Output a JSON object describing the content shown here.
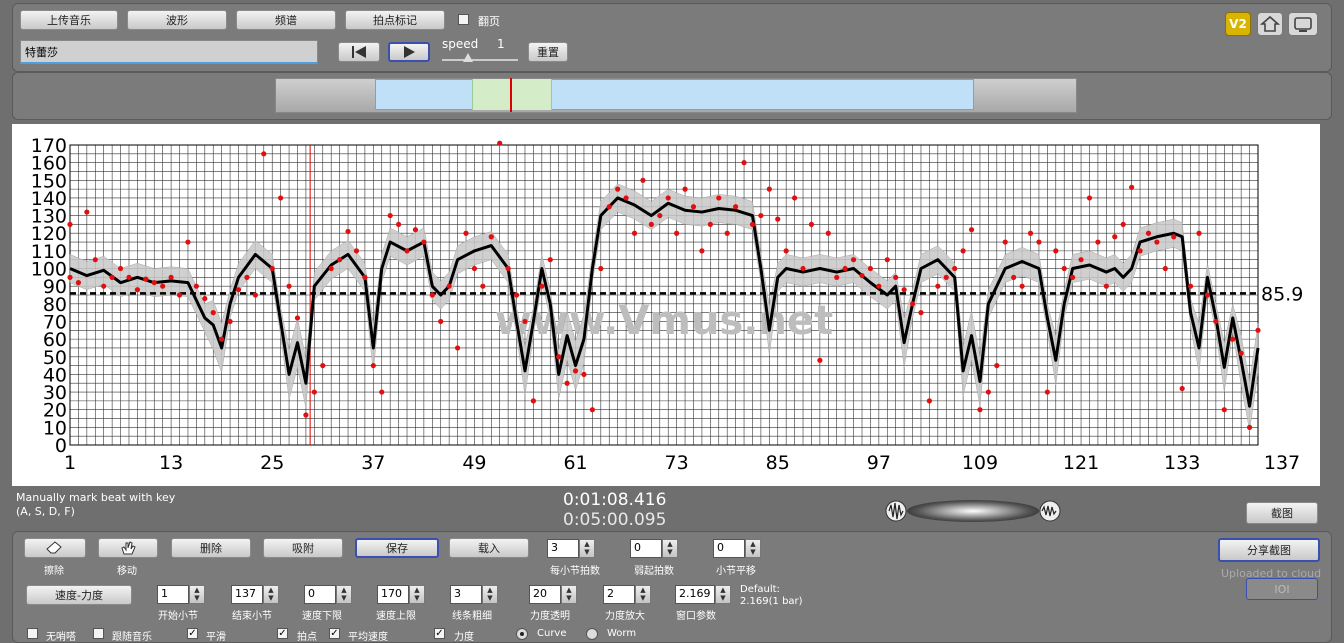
{
  "top": {
    "upload_label": "上传音乐",
    "waveform_label": "波形",
    "spectrum_label": "频谱",
    "beat_mark_label": "拍点标记",
    "flip_label": "翻页",
    "file_name": "特蕾莎",
    "speed_label": "speed",
    "speed_value": "1",
    "reset_label": "重置",
    "v2_label": "V2"
  },
  "colors": {
    "data_points": "#e01010",
    "curve": "#000000",
    "band": "#c8c8c8",
    "timeline_selection": "#bfe0f7",
    "accent_border": "#3a4fae"
  },
  "chart_data": {
    "type": "scatter",
    "ylim": [
      0,
      170
    ],
    "xlim": [
      1,
      137
    ],
    "yticks": [
      "0",
      "10",
      "20",
      "30",
      "40",
      "50",
      "60",
      "70",
      "80",
      "90",
      "100",
      "110",
      "120",
      "130",
      "140",
      "150",
      "160",
      "170"
    ],
    "xticks": [
      "1",
      "13",
      "25",
      "37",
      "49",
      "61",
      "73",
      "85",
      "97",
      "109",
      "121",
      "133",
      "137"
    ],
    "average_value": 85.9,
    "average_label": "85.9",
    "cursor_x": 29.5,
    "watermark": "www.Vmus.net",
    "curve": [
      [
        1,
        100
      ],
      [
        3,
        96
      ],
      [
        5,
        99
      ],
      [
        7,
        92
      ],
      [
        9,
        95
      ],
      [
        11,
        92
      ],
      [
        13,
        93
      ],
      [
        15,
        92
      ],
      [
        16,
        82
      ],
      [
        17,
        72
      ],
      [
        18,
        68
      ],
      [
        19,
        55
      ],
      [
        20,
        80
      ],
      [
        21,
        95
      ],
      [
        23,
        108
      ],
      [
        25,
        100
      ],
      [
        26,
        70
      ],
      [
        27,
        40
      ],
      [
        28,
        58
      ],
      [
        29,
        35
      ],
      [
        30,
        90
      ],
      [
        32,
        102
      ],
      [
        34,
        108
      ],
      [
        36,
        95
      ],
      [
        37,
        55
      ],
      [
        38,
        100
      ],
      [
        39,
        115
      ],
      [
        41,
        110
      ],
      [
        43,
        115
      ],
      [
        44,
        90
      ],
      [
        45,
        85
      ],
      [
        46,
        90
      ],
      [
        47,
        105
      ],
      [
        49,
        110
      ],
      [
        51,
        113
      ],
      [
        53,
        100
      ],
      [
        54,
        70
      ],
      [
        55,
        42
      ],
      [
        56,
        70
      ],
      [
        57,
        100
      ],
      [
        58,
        80
      ],
      [
        59,
        40
      ],
      [
        60,
        62
      ],
      [
        61,
        45
      ],
      [
        62,
        60
      ],
      [
        63,
        100
      ],
      [
        64,
        130
      ],
      [
        66,
        140
      ],
      [
        68,
        136
      ],
      [
        70,
        130
      ],
      [
        72,
        137
      ],
      [
        74,
        133
      ],
      [
        76,
        132
      ],
      [
        78,
        134
      ],
      [
        80,
        133
      ],
      [
        82,
        130
      ],
      [
        83,
        100
      ],
      [
        84,
        65
      ],
      [
        85,
        95
      ],
      [
        86,
        100
      ],
      [
        88,
        98
      ],
      [
        90,
        100
      ],
      [
        92,
        98
      ],
      [
        94,
        100
      ],
      [
        96,
        92
      ],
      [
        98,
        85
      ],
      [
        99,
        90
      ],
      [
        100,
        58
      ],
      [
        101,
        80
      ],
      [
        102,
        100
      ],
      [
        104,
        105
      ],
      [
        106,
        95
      ],
      [
        107,
        42
      ],
      [
        108,
        62
      ],
      [
        109,
        36
      ],
      [
        110,
        80
      ],
      [
        112,
        100
      ],
      [
        114,
        104
      ],
      [
        116,
        100
      ],
      [
        117,
        72
      ],
      [
        118,
        48
      ],
      [
        119,
        80
      ],
      [
        120,
        100
      ],
      [
        122,
        102
      ],
      [
        124,
        98
      ],
      [
        125,
        100
      ],
      [
        126,
        95
      ],
      [
        127,
        100
      ],
      [
        128,
        115
      ],
      [
        130,
        118
      ],
      [
        132,
        120
      ],
      [
        133,
        118
      ],
      [
        134,
        75
      ],
      [
        135,
        55
      ],
      [
        136,
        95
      ],
      [
        137,
        72
      ],
      [
        138,
        44
      ],
      [
        139,
        72
      ],
      [
        140,
        48
      ],
      [
        141,
        22
      ],
      [
        142,
        55
      ]
    ],
    "points": [
      [
        1,
        125
      ],
      [
        1,
        95
      ],
      [
        2,
        92
      ],
      [
        3,
        132
      ],
      [
        4,
        105
      ],
      [
        5,
        90
      ],
      [
        6,
        95
      ],
      [
        7,
        100
      ],
      [
        8,
        95
      ],
      [
        9,
        88
      ],
      [
        10,
        94
      ],
      [
        11,
        92
      ],
      [
        12,
        90
      ],
      [
        13,
        95
      ],
      [
        14,
        85
      ],
      [
        15,
        115
      ],
      [
        16,
        90
      ],
      [
        17,
        83
      ],
      [
        18,
        75
      ],
      [
        19,
        60
      ],
      [
        20,
        70
      ],
      [
        21,
        88
      ],
      [
        22,
        95
      ],
      [
        23,
        85
      ],
      [
        24,
        165
      ],
      [
        25,
        100
      ],
      [
        26,
        140
      ],
      [
        27,
        90
      ],
      [
        28,
        72
      ],
      [
        29,
        17
      ],
      [
        30,
        30
      ],
      [
        31,
        45
      ],
      [
        32,
        100
      ],
      [
        33,
        105
      ],
      [
        34,
        121
      ],
      [
        35,
        110
      ],
      [
        36,
        95
      ],
      [
        37,
        45
      ],
      [
        38,
        30
      ],
      [
        39,
        130
      ],
      [
        40,
        125
      ],
      [
        41,
        110
      ],
      [
        42,
        122
      ],
      [
        43,
        115
      ],
      [
        44,
        85
      ],
      [
        45,
        70
      ],
      [
        46,
        90
      ],
      [
        47,
        55
      ],
      [
        48,
        120
      ],
      [
        49,
        100
      ],
      [
        50,
        90
      ],
      [
        51,
        118
      ],
      [
        52,
        171
      ],
      [
        53,
        100
      ],
      [
        54,
        85
      ],
      [
        55,
        70
      ],
      [
        56,
        25
      ],
      [
        57,
        90
      ],
      [
        58,
        105
      ],
      [
        59,
        50
      ],
      [
        60,
        35
      ],
      [
        61,
        42
      ],
      [
        62,
        40
      ],
      [
        63,
        20
      ],
      [
        64,
        100
      ],
      [
        65,
        135
      ],
      [
        66,
        145
      ],
      [
        67,
        140
      ],
      [
        68,
        120
      ],
      [
        69,
        150
      ],
      [
        70,
        125
      ],
      [
        71,
        130
      ],
      [
        72,
        140
      ],
      [
        73,
        120
      ],
      [
        74,
        145
      ],
      [
        75,
        135
      ],
      [
        76,
        110
      ],
      [
        77,
        125
      ],
      [
        78,
        140
      ],
      [
        79,
        120
      ],
      [
        80,
        135
      ],
      [
        81,
        160
      ],
      [
        82,
        125
      ],
      [
        83,
        130
      ],
      [
        84,
        145
      ],
      [
        85,
        128
      ],
      [
        86,
        110
      ],
      [
        87,
        140
      ],
      [
        88,
        100
      ],
      [
        89,
        125
      ],
      [
        90,
        48
      ],
      [
        91,
        120
      ],
      [
        92,
        95
      ],
      [
        93,
        100
      ],
      [
        94,
        105
      ],
      [
        95,
        96
      ],
      [
        96,
        100
      ],
      [
        97,
        90
      ],
      [
        98,
        105
      ],
      [
        99,
        95
      ],
      [
        100,
        88
      ],
      [
        101,
        80
      ],
      [
        102,
        75
      ],
      [
        103,
        25
      ],
      [
        104,
        90
      ],
      [
        105,
        95
      ],
      [
        106,
        100
      ],
      [
        107,
        110
      ],
      [
        108,
        122
      ],
      [
        109,
        20
      ],
      [
        110,
        30
      ],
      [
        111,
        45
      ],
      [
        112,
        115
      ],
      [
        113,
        95
      ],
      [
        114,
        90
      ],
      [
        115,
        120
      ],
      [
        116,
        115
      ],
      [
        117,
        30
      ],
      [
        118,
        110
      ],
      [
        119,
        100
      ],
      [
        120,
        95
      ],
      [
        121,
        105
      ],
      [
        122,
        140
      ],
      [
        123,
        115
      ],
      [
        124,
        90
      ],
      [
        125,
        118
      ],
      [
        126,
        125
      ],
      [
        127,
        146
      ],
      [
        128,
        110
      ],
      [
        129,
        120
      ],
      [
        130,
        115
      ],
      [
        131,
        100
      ],
      [
        132,
        118
      ],
      [
        133,
        32
      ],
      [
        134,
        90
      ],
      [
        135,
        120
      ],
      [
        136,
        85
      ],
      [
        137,
        70
      ],
      [
        138,
        20
      ],
      [
        139,
        60
      ],
      [
        140,
        52
      ],
      [
        141,
        10
      ],
      [
        142,
        65
      ]
    ]
  },
  "time": {
    "current": "0:01:08.416",
    "total": "0:05:00.095"
  },
  "hint": {
    "line1": "Manually mark beat with key",
    "line2": "(A, S, D, F)"
  },
  "screenshot_label": "截图",
  "tools": {
    "erase": "擦除",
    "move": "移动",
    "delete": "删除",
    "absorb": "吸附",
    "save": "保存",
    "load": "载入",
    "speed_force": "速度-力度"
  },
  "params": {
    "beats_per_bar": {
      "label": "每小节拍数",
      "value": "3"
    },
    "pickup_beats": {
      "label": "弱起拍数",
      "value": "0"
    },
    "bar_shift": {
      "label": "小节平移",
      "value": "0"
    },
    "start_bar": {
      "label": "开始小节",
      "value": "1"
    },
    "end_bar": {
      "label": "结束小节",
      "value": "137"
    },
    "speed_min": {
      "label": "速度下限",
      "value": "0"
    },
    "speed_max": {
      "label": "速度上限",
      "value": "170"
    },
    "line_width": {
      "label": "线条粗细",
      "value": "3"
    },
    "force_alpha": {
      "label": "力度透明",
      "value": "20"
    },
    "force_zoom": {
      "label": "力度放大",
      "value": "2"
    },
    "window_param": {
      "label": "窗口参数",
      "value": "2.169"
    },
    "default_line1": "Default:",
    "default_line2": "2.169(1 bar)"
  },
  "share": {
    "label": "分享截图",
    "uploaded": "Uploaded to cloud",
    "ioi": "IOI"
  },
  "options": {
    "no_metronome": "无哨嗒",
    "follow_music": "跟随音乐",
    "smooth": "平滑",
    "beat_points": "拍点",
    "avg_speed": "平均速度",
    "force": "力度",
    "curve": "Curve",
    "worm": "Worm"
  }
}
